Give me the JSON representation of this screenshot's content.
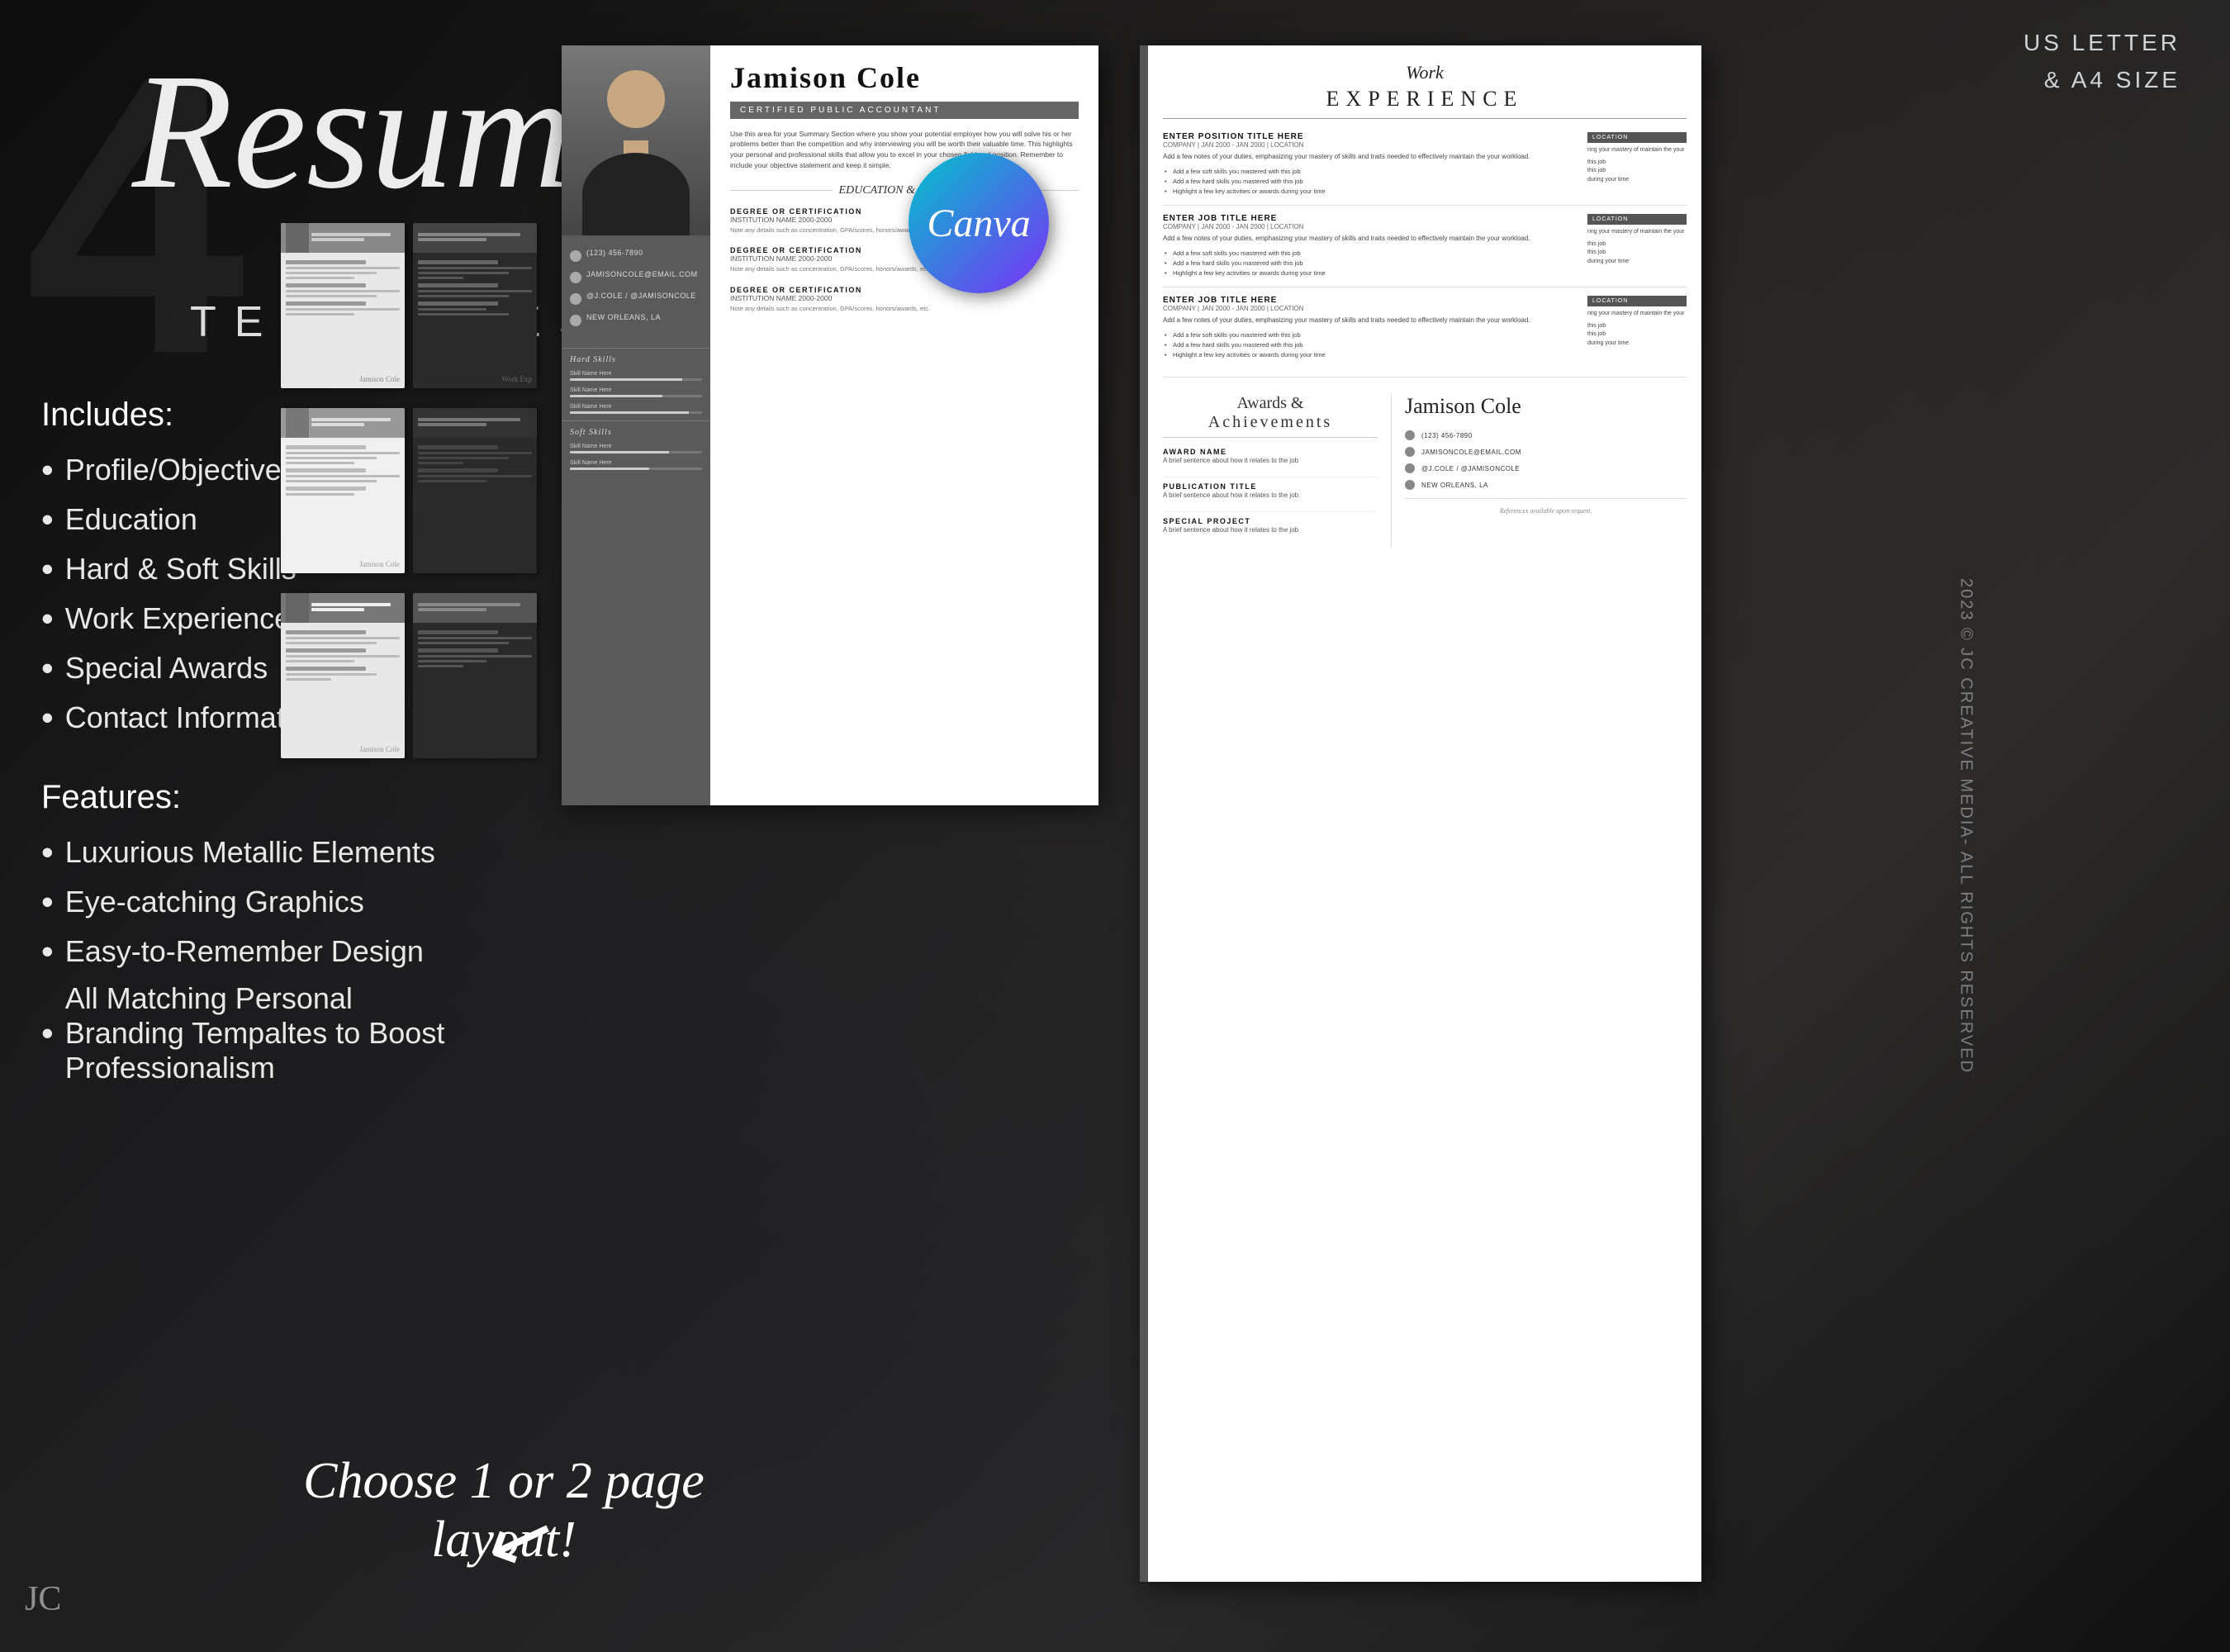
{
  "badge": {
    "us_letter": "US LETTER",
    "a4": "& A4 SIZE"
  },
  "hero": {
    "number": "4",
    "script_title": "Resume",
    "templates_label": "TEMPLATES"
  },
  "includes": {
    "label": "Includes:",
    "items": [
      "Profile/Objective",
      "Education",
      "Hard & Soft Skills",
      "Work Experience",
      "Special Awards",
      "Contact Information"
    ]
  },
  "features": {
    "label": "Features:",
    "items": [
      "Luxurious Metallic Elements",
      "Eye-catching Graphics",
      "Easy-to-Remember Design",
      "All Matching Personal Branding Tempaltes to Boost Professionalism"
    ]
  },
  "cta": "Choose 1 or 2 page layout!",
  "copyright": "2023 © JC CREATIVE MEDIA- ALL RIGHTS RESERVED",
  "jc_logo": "JC",
  "resume": {
    "name": "Jamison Cole",
    "title": "CERTIFIED PUBLIC ACCOUNTANT",
    "phone": "(123) 456-7890",
    "email": "JAMISONCOLE@EMAIL.COM",
    "social": "@J.COLE / @JAMISONCOLE",
    "location": "NEW ORLEANS, LA",
    "summary": "Use this area for your Summary Section where you show your potential employer how you will solve his or her problems better than the competition and why interviewing you will be worth their valuable time. This highlights your personal and professional skills that allow you to excel in your chosen field and position. Remember to include your objective statement and keep it simple.",
    "education_section": "EDUCATION & TRAINING",
    "education_items": [
      {
        "degree": "DEGREE OR CERTIFICATION",
        "institution": "INSTITUTION NAME",
        "years": "2000-2000",
        "notes": "Note any details such as concentration, GPA/scores, honors/awards, etc."
      },
      {
        "degree": "DEGREE OR CERTIFICATION",
        "institution": "INSTITUTION NAME",
        "years": "2000-2000",
        "notes": "Note any details such as concentration, GPA/scores, honors/awards, etc."
      },
      {
        "degree": "DEGREE OR CERTIFICATION",
        "institution": "INSTITUTION NAME",
        "years": "2000-2000",
        "notes": "Note any details such as concentration, GPA/scores, honors/awards, etc."
      }
    ],
    "work_section_script": "Work",
    "work_section_caps": "EXPERIENCE",
    "work_items": [
      {
        "title": "ENTER POSITION TITLE HERE",
        "meta": "COMPANY | JAN 2000 - JAN 2000 | LOCATION",
        "desc": "Add a few notes of your duties, emphasizing your mastery of skills and traits needed to effectively maintain the your workload.",
        "bullets": [
          "Add a few soft skills you mastered with this job",
          "Add a few hard skills you mastered with this job",
          "Highlight a few key activities or awards during your time"
        ]
      },
      {
        "title": "ENTER JOB TITLE HERE",
        "meta": "COMPANY | JAN 2000 - JAN 2000 | LOCATION",
        "desc": "Add a few notes of your duties, emphasizing your mastery of skills and traits needed to effectively maintain the your workload.",
        "bullets": [
          "Add a few soft skills you mastered with this job",
          "Add a few hard skills you mastered with this job",
          "Highlight a few key activities or awards during your time"
        ]
      },
      {
        "title": "ENTER JOB TITLE HERE",
        "meta": "COMPANY | JAN 2000 - JAN 2000 | LOCATION",
        "desc": "Add a few notes of your duties, emphasizing your mastery of skills and traits needed to effectively maintain the your workload.",
        "bullets": [
          "Add a few soft skills you mastered with this job",
          "Add a few hard skills you mastered with this job",
          "Highlight a few key activities or awards during your time"
        ]
      }
    ],
    "awards_script": "Awards &",
    "awards_caps": "Achievements",
    "award_items": [
      {
        "name": "AWARD NAME",
        "desc": "A brief sentence about how it relates to the job"
      },
      {
        "name": "PUBLICATION TITLE",
        "desc": "A brief sentence about how it relates to the job"
      },
      {
        "name": "SPECIAL PROJECT",
        "desc": "A brief sentence about how it relates to the job"
      }
    ],
    "contact_name": "Jamison Cole",
    "references": "References available upon request."
  },
  "canva": "Canva"
}
